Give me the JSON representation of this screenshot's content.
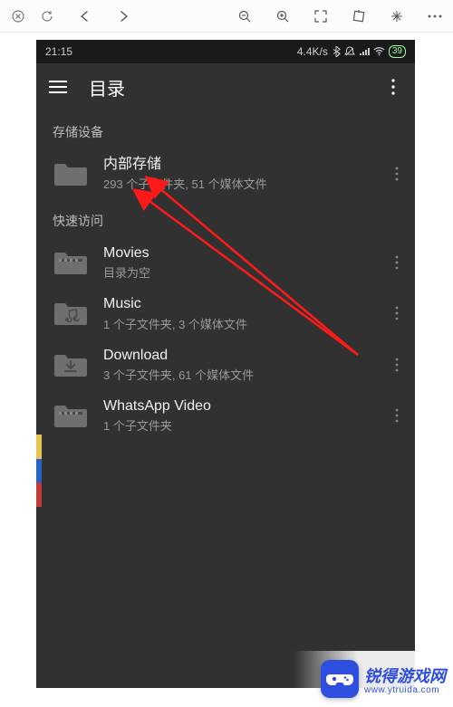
{
  "status_bar": {
    "time": "21:15",
    "net_speed": "4.4K/s",
    "battery_text": "39"
  },
  "app_bar": {
    "title": "目录"
  },
  "sections": {
    "storage": {
      "header": "存储设备",
      "item": {
        "title": "内部存储",
        "subtitle": "293 个子文件夹, 51 个媒体文件"
      }
    },
    "quick": {
      "header": "快速访问",
      "items": [
        {
          "title": "Movies",
          "subtitle": "目录为空"
        },
        {
          "title": "Music",
          "subtitle": "1 个子文件夹, 3 个媒体文件"
        },
        {
          "title": "Download",
          "subtitle": "3 个子文件夹, 61 个媒体文件"
        },
        {
          "title": "WhatsApp Video",
          "subtitle": "1 个子文件夹"
        }
      ]
    }
  },
  "watermark": {
    "name": "锐得游戏网",
    "url": "www.ytruida.com"
  }
}
